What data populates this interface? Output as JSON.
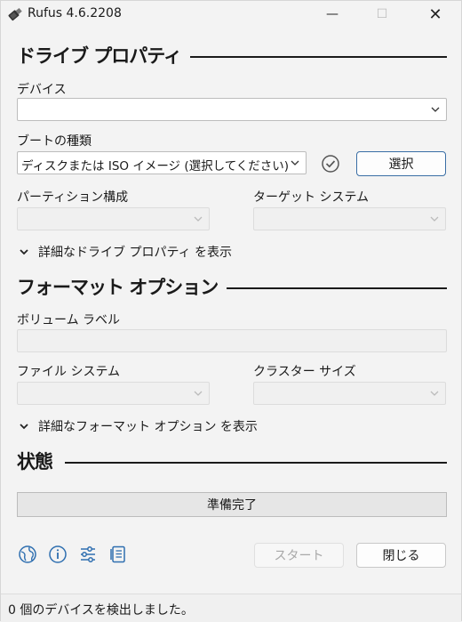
{
  "window": {
    "title": "Rufus 4.6.2208",
    "minimize": "—",
    "maximize": "☐",
    "close": "✕"
  },
  "drive_properties": {
    "heading": "ドライブ プロパティ",
    "device_label": "デバイス",
    "device_value": "",
    "boot_label": "ブートの種類",
    "boot_value": "ディスクまたは ISO イメージ (選択してください)",
    "select_button": "選択",
    "partition_label": "パーティション構成",
    "target_label": "ターゲット システム",
    "advanced_toggle": "詳細なドライブ プロパティ を表示"
  },
  "format_options": {
    "heading": "フォーマット オプション",
    "volume_label": "ボリューム ラベル",
    "volume_value": "",
    "filesystem_label": "ファイル システム",
    "cluster_label": "クラスター サイズ",
    "advanced_toggle": "詳細なフォーマット オプション を表示"
  },
  "status": {
    "heading": "状態",
    "progress_text": "準備完了",
    "progress_fraction": 0
  },
  "toolbar": {
    "icons": [
      "globe-icon",
      "info-icon",
      "settings-sliders-icon",
      "log-icon"
    ],
    "start_button": "スタート",
    "close_button": "閉じる"
  },
  "statusbar": {
    "text": "0 個のデバイスを検出しました。"
  },
  "colors": {
    "accent_border": "#3a6ea5",
    "background": "#f3f3f3"
  }
}
